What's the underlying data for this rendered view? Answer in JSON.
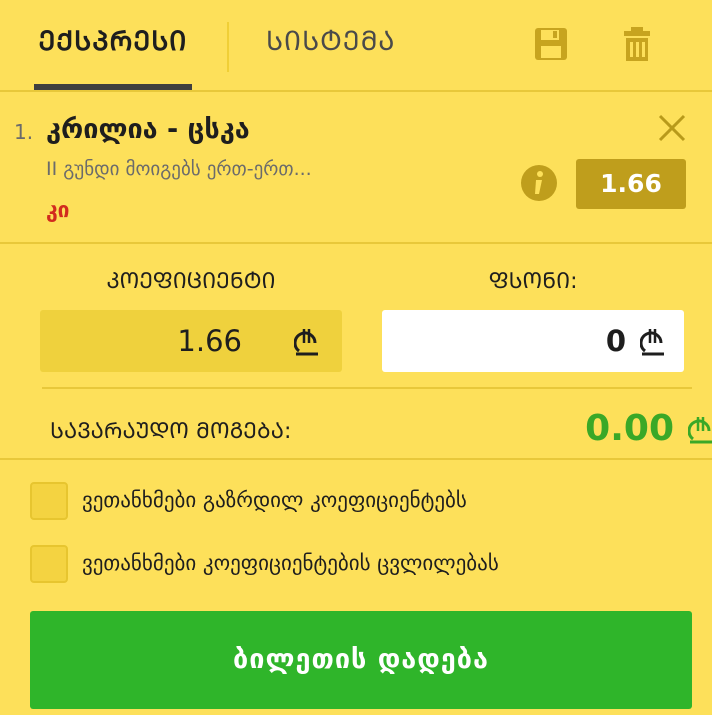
{
  "tabs": {
    "express_label": "ᲔᲥᲡᲞᲠᲔᲡᲘ",
    "system_label": "ᲡᲘᲡᲢᲔᲛᲐ"
  },
  "icons": {
    "save": "save-icon",
    "delete": "trash-icon",
    "close": "close-icon",
    "info": "info-icon",
    "currency": "lari-icon"
  },
  "bet": {
    "number": "1.",
    "title": "კრილია - ცსკა",
    "description": "II გუნდი მოიგებს ერთ-ერთ...",
    "pick": "კი",
    "odds": "1.66"
  },
  "coefficient": {
    "label": "ᲙᲝᲔᲤᲘᲪᲘᲔᲜᲢᲘ",
    "value": "1.66"
  },
  "stake": {
    "label": "ᲤᲡᲝᲜᲘ:",
    "value": "0"
  },
  "potential_win": {
    "label": "ᲡᲐᲕᲐᲠᲐᲣᲓᲝ ᲛᲝᲒᲔᲑᲐ:",
    "value": "0.00"
  },
  "checkboxes": [
    {
      "label": "ვეთანხმები გაზრდილ კოეფიციენტებს",
      "checked": false
    },
    {
      "label": "ვეთანხმები კოეფიციენტების ცვლილებას",
      "checked": false
    }
  ],
  "place_bet": {
    "label": "ბილეთის დადება"
  },
  "colors": {
    "background": "#fde05a",
    "accent_green": "#2fb52a",
    "odds_badge": "#bf9e1c",
    "pick_red": "#d22b1e",
    "win_green": "#3aa827"
  }
}
